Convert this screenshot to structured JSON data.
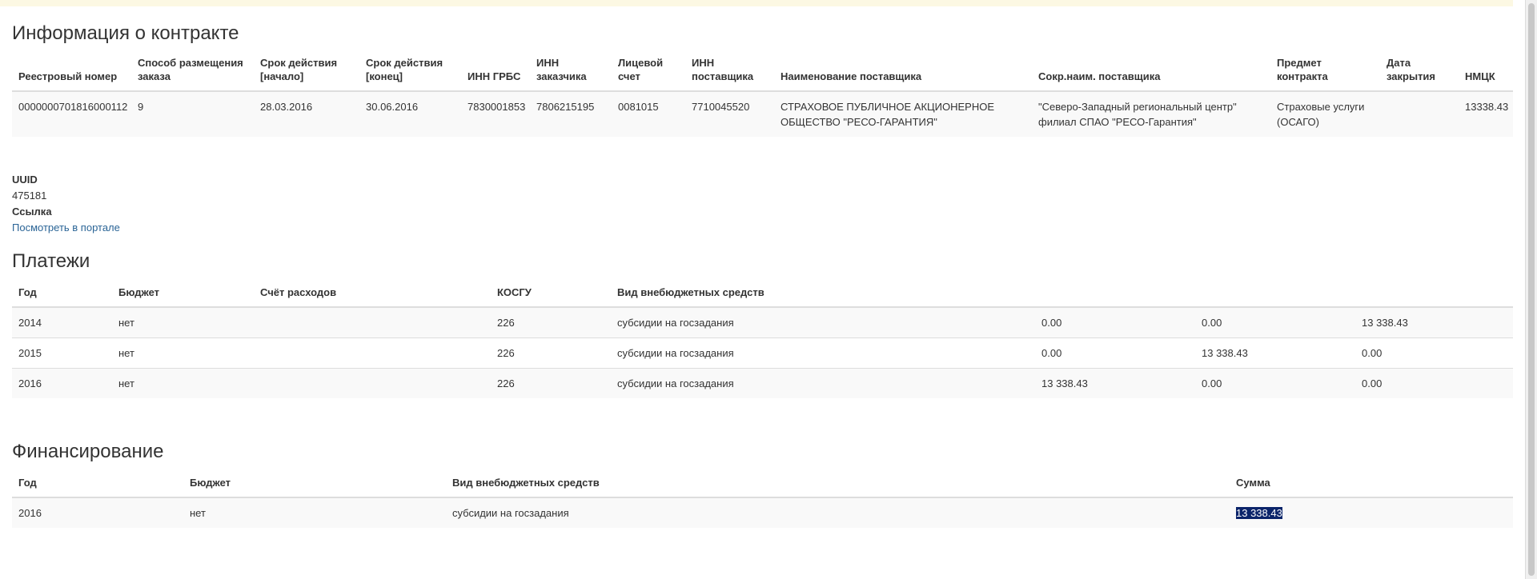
{
  "contract": {
    "title": "Информация о контракте",
    "headers": [
      "Реестровый номер",
      "Способ размещения заказа",
      "Срок действия [начало]",
      "Срок действия [конец]",
      "ИНН ГРБС",
      "ИНН заказчика",
      "Лицевой счет",
      "ИНН поставщика",
      "Наименование поставщика",
      "Сокр.наим. поставщика",
      "Предмет контракта",
      "Дата закрытия",
      "НМЦК"
    ],
    "row": [
      "0000000701816000112",
      "9",
      "28.03.2016",
      "30.06.2016",
      "7830001853",
      "7806215195",
      "0081015",
      "7710045520",
      "СТРАХОВОЕ ПУБЛИЧНОЕ АКЦИОНЕРНОЕ ОБЩЕСТВО \"РЕСО-ГАРАНТИЯ\"",
      "\"Северо-Западный региональный центр\" филиал СПАО \"РЕСО-Гарантия\"",
      "Страховые услуги (ОСАГО)",
      "",
      "13338.43"
    ]
  },
  "meta": {
    "uuid_label": "UUID",
    "uuid_value": "475181",
    "link_label": "Ссылка",
    "link_text": "Посмотреть в портале"
  },
  "payments": {
    "title": "Платежи",
    "headers": [
      "Год",
      "Бюджет",
      "Счёт расходов",
      "КОСГУ",
      "Вид внебюджетных средств",
      "",
      "",
      ""
    ],
    "rows": [
      [
        "2014",
        "нет",
        "",
        "226",
        "субсидии на госзадания",
        "0.00",
        "0.00",
        "13 338.43"
      ],
      [
        "2015",
        "нет",
        "",
        "226",
        "субсидии на госзадания",
        "0.00",
        "13 338.43",
        "0.00"
      ],
      [
        "2016",
        "нет",
        "",
        "226",
        "субсидии на госзадания",
        "13 338.43",
        "0.00",
        "0.00"
      ]
    ]
  },
  "financing": {
    "title": "Финансирование",
    "headers": [
      "Год",
      "Бюджет",
      "Вид внебюджетных средств",
      "Сумма"
    ],
    "row": [
      "2016",
      "нет",
      "субсидии на госзадания",
      "13 338.43"
    ]
  },
  "colors": {
    "banner": "#fcf8e3",
    "link": "#2a6496",
    "stripe": "#f9f9f9",
    "selection": "#0a246a"
  }
}
